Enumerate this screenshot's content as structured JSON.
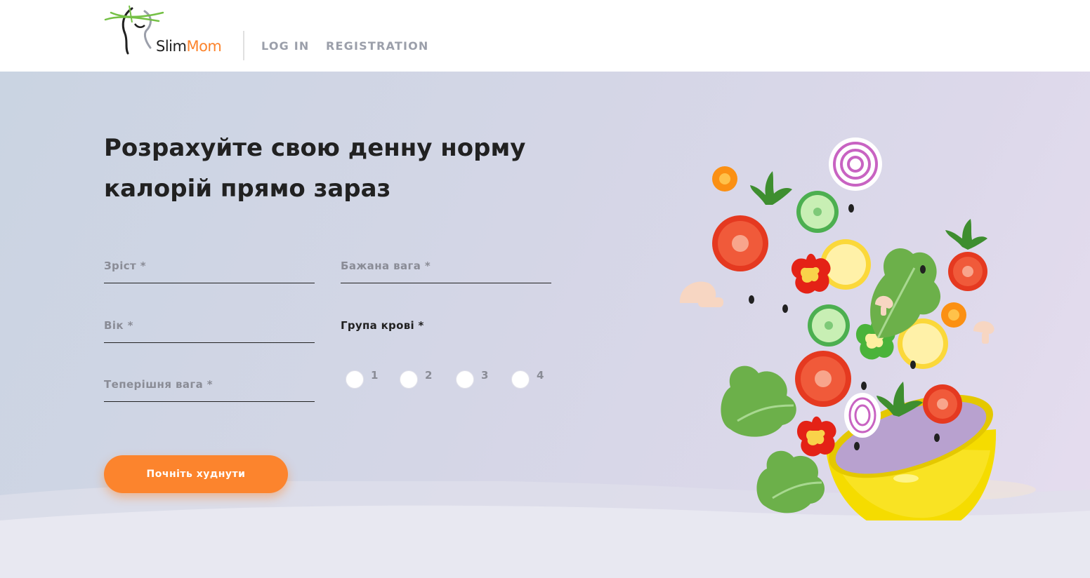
{
  "header": {
    "logo": {
      "text_slim": "Slim",
      "text_mom": "Mom"
    },
    "nav": {
      "login": "LOG IN",
      "registration": "REGISTRATION"
    }
  },
  "main": {
    "title_line1": "Розрахуйте свою денну норму",
    "title_line2": "калорій прямо зараз",
    "form": {
      "height_placeholder": "Зріст *",
      "desired_weight_placeholder": "Бажана вага *",
      "age_placeholder": "Вік *",
      "current_weight_placeholder": "Теперішня вага *",
      "blood_group_label": "Група крові *",
      "blood_options": [
        "1",
        "2",
        "3",
        "4"
      ],
      "submit_label": "Почніть худнути"
    }
  },
  "colors": {
    "accent": "#fc842d",
    "nav_text": "#9b9faa",
    "text_dark": "#212121"
  }
}
